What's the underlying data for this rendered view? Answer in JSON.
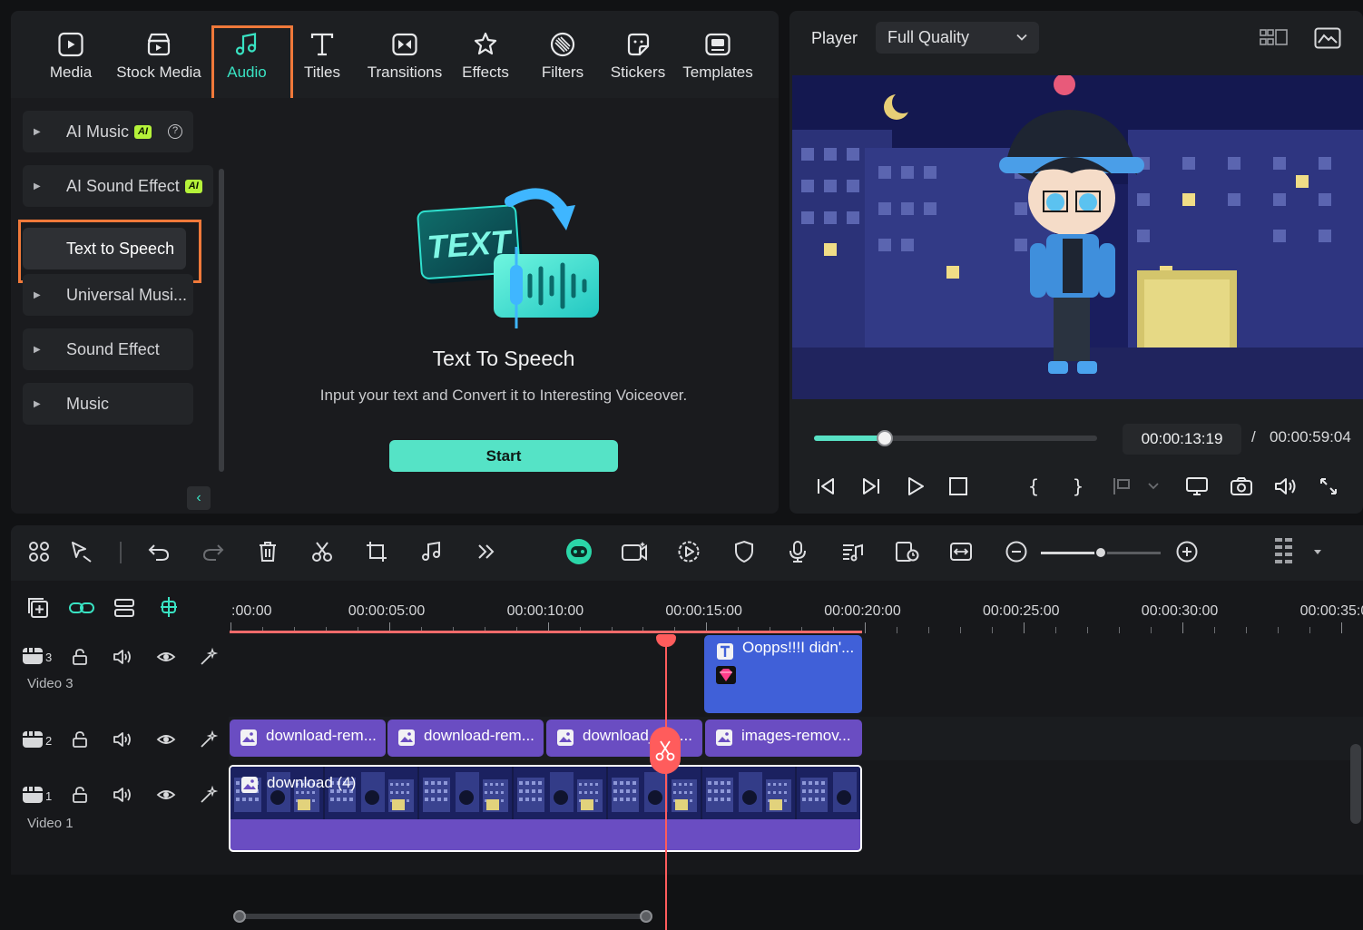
{
  "library": {
    "tabs": [
      {
        "label": "Media",
        "icon": "media-icon"
      },
      {
        "label": "Stock Media",
        "icon": "stock-media-icon"
      },
      {
        "label": "Audio",
        "icon": "audio-icon",
        "active": true
      },
      {
        "label": "Titles",
        "icon": "titles-icon"
      },
      {
        "label": "Transitions",
        "icon": "transitions-icon"
      },
      {
        "label": "Effects",
        "icon": "effects-icon"
      },
      {
        "label": "Filters",
        "icon": "filters-icon"
      },
      {
        "label": "Stickers",
        "icon": "stickers-icon"
      },
      {
        "label": "Templates",
        "icon": "templates-icon"
      }
    ],
    "sidebar": [
      {
        "label": "AI Music",
        "badge": "AI",
        "help": "?"
      },
      {
        "label": "AI Sound Effect",
        "badge": "AI"
      },
      {
        "label": "Text to Speech",
        "selected": true
      },
      {
        "label": "Universal Musi..."
      },
      {
        "label": "Sound Effect"
      },
      {
        "label": "Music"
      }
    ],
    "tts": {
      "art_text": "TEXT",
      "title": "Text To Speech",
      "description": "Input your text and Convert it to Interesting Voiceover.",
      "start_label": "Start"
    }
  },
  "player": {
    "label": "Player",
    "quality": "Full Quality",
    "progress": 0.25,
    "current_time": "00:00:13:19",
    "separator": "/",
    "total_time": "00:00:59:04"
  },
  "timeline": {
    "zoom": 0.5,
    "ruler": [
      "00:00",
      "00:00:05:00",
      "00:00:10:00",
      "00:00:15:00",
      "00:00:20:00",
      "00:00:25:00",
      "00:00:30:00",
      "00:00:35:00"
    ],
    "tracks": [
      {
        "num": "3",
        "name": "Video 3"
      },
      {
        "num": "2",
        "name": ""
      },
      {
        "num": "1",
        "name": "Video 1"
      }
    ],
    "clips": {
      "title_clip": "Oopps!!!I didn'...",
      "track2": [
        "download-rem...",
        "download-rem...",
        "download_1_-...",
        "images-remov..."
      ],
      "main": "download (4)"
    }
  },
  "colors": {
    "accent": "#39e3c3",
    "highlight": "#f0793a",
    "playhead": "#ff5c5c",
    "clip_purple": "#6a4dc2",
    "clip_blue": "#4060d8"
  }
}
